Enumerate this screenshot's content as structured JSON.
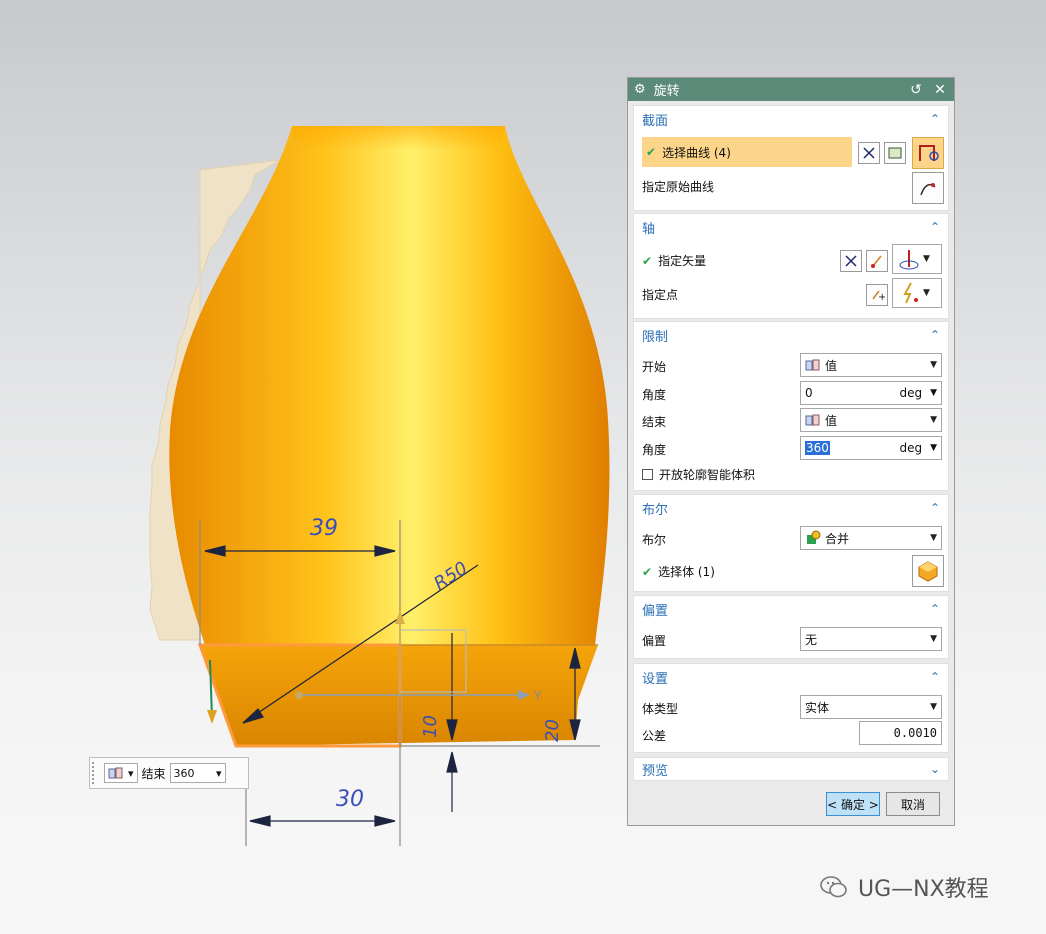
{
  "canvas": {
    "dimensions": {
      "d39": "39",
      "d30": "30",
      "d10": "10",
      "d20": "20",
      "r50": "R50"
    },
    "axis_label": "Y"
  },
  "mini_toolbar": {
    "end_label": "结束",
    "end_value": "360"
  },
  "dialog": {
    "title": "旋转",
    "section": {
      "label": "截面",
      "select_curve": "选择曲线 (4)",
      "specify_origin_curve": "指定原始曲线"
    },
    "axis": {
      "label": "轴",
      "specify_vector": "指定矢量",
      "specify_point": "指定点"
    },
    "limits": {
      "label": "限制",
      "start_label": "开始",
      "start_value": "值",
      "angle1_label": "角度",
      "angle1_value": "0",
      "angle1_unit": "deg",
      "end_label": "结束",
      "end_value": "值",
      "angle2_label": "角度",
      "angle2_value": "360",
      "angle2_unit": "deg",
      "open_profile": "开放轮廓智能体积"
    },
    "boolean": {
      "label": "布尔",
      "bool_label": "布尔",
      "bool_value": "合并",
      "select_body": "选择体 (1)"
    },
    "offset": {
      "label": "偏置",
      "offset_label": "偏置",
      "offset_value": "无"
    },
    "settings": {
      "label": "设置",
      "body_type_label": "体类型",
      "body_type_value": "实体",
      "tolerance_label": "公差",
      "tolerance_value": "0.0010"
    },
    "preview": {
      "label": "预览"
    },
    "ok_button": "< 确定 >",
    "cancel_button": "取消"
  },
  "watermark": {
    "text": "UG—NX教程"
  }
}
